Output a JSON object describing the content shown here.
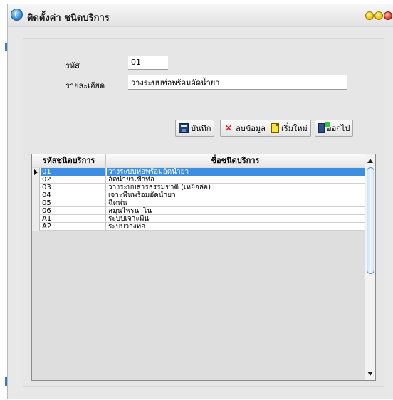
{
  "window": {
    "title": "ติดตั้งค่า ชนิดบริการ"
  },
  "form": {
    "code_label": "รหัส",
    "code_value": "01",
    "detail_label": "รายละเอียด",
    "detail_value": "วางระบบท่อพร้อมอัดน้ำยา"
  },
  "toolbar": {
    "save_label": "บันทึก",
    "delete_label": "ลบข้อมูล",
    "new_label": "เริ่มใหม่",
    "exit_label": "ออกไป"
  },
  "grid": {
    "columns": [
      "รหัสชนิดบริการ",
      "ชื่อชนิดบริการ"
    ],
    "rows": [
      {
        "code": "01",
        "name": "วางระบบท่อพร้อมอัดน้ำยา"
      },
      {
        "code": "02",
        "name": "อัดน้ำยาเข้าท่อ"
      },
      {
        "code": "03",
        "name": "วางระบบสารธรรมชาติ (เหยื่อล่อ)"
      },
      {
        "code": "04",
        "name": "เจาะพื้นพร้อมอัดน้ำยา"
      },
      {
        "code": "05",
        "name": "ฉีดพ่น"
      },
      {
        "code": "06",
        "name": "สมุนไพรนาโน"
      },
      {
        "code": "A1",
        "name": "ระบบเจาะพื้น"
      },
      {
        "code": "A2",
        "name": "ระบบวางท่อ"
      }
    ],
    "selected_index": 0
  },
  "colors": {
    "selection": "#3d8ee0",
    "window_bg": "#e8e8e8"
  }
}
